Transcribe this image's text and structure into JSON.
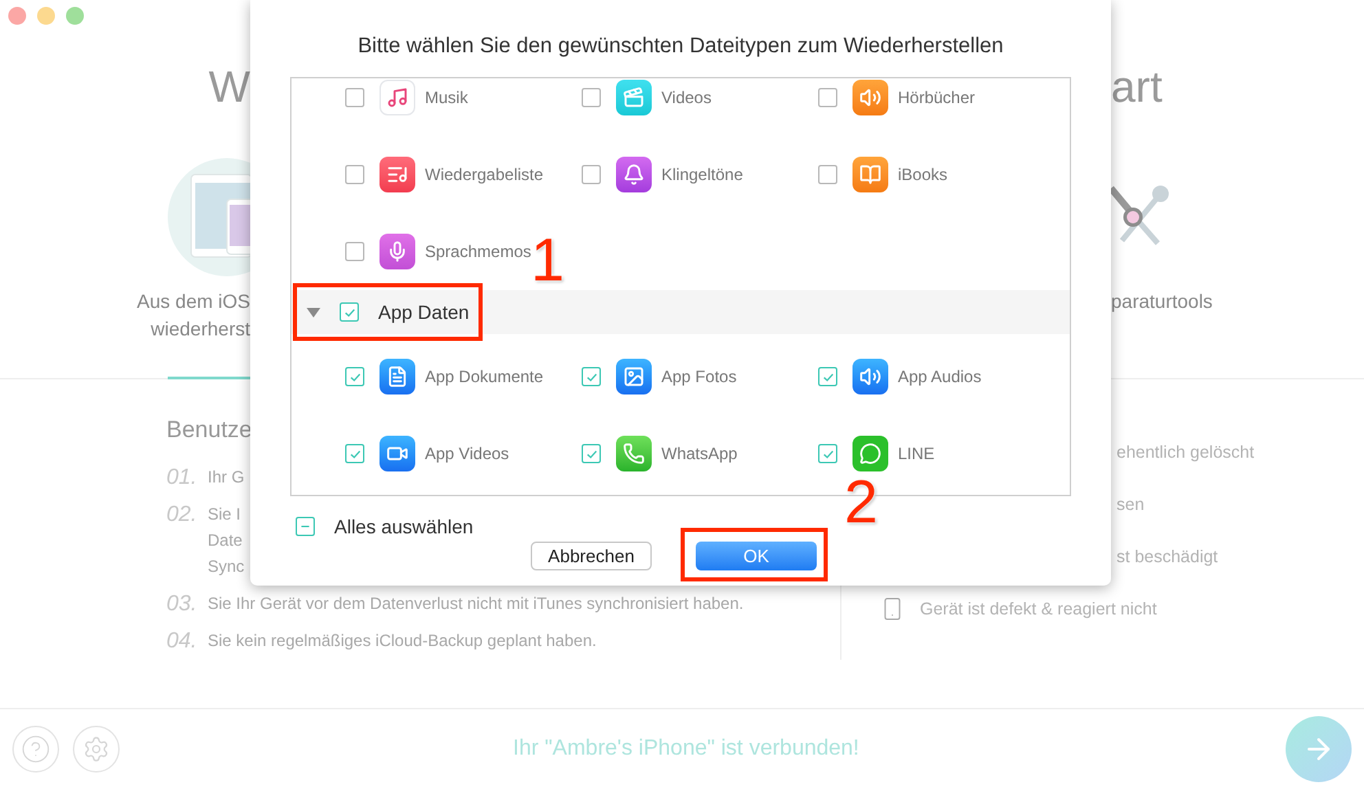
{
  "background": {
    "heading_left": "W",
    "heading_right": "art",
    "mode_left": [
      "Aus dem iOS",
      "wiederherst"
    ],
    "mode_right": "paraturtools",
    "guide": {
      "title": "Benutze",
      "items": [
        {
          "number": "01.",
          "lines": [
            "Ihr G"
          ]
        },
        {
          "number": "02.",
          "lines": [
            "Sie I",
            "Date",
            "Sync"
          ]
        },
        {
          "number": "03.",
          "lines": [
            "Sie Ihr Gerät vor dem Datenverlust nicht mit iTunes synchronisiert haben."
          ]
        },
        {
          "number": "04.",
          "lines": [
            "Sie kein regelmäßiges iCloud-Backup geplant haben."
          ]
        }
      ]
    },
    "causes": [
      {
        "text": "ehentlich gelöscht",
        "kind": "cut"
      },
      {
        "text": "sen",
        "kind": "cut"
      },
      {
        "text": "st beschädigt",
        "kind": "cut"
      },
      {
        "text": "Gerät ist defekt & reagiert nicht",
        "kind": "full"
      }
    ]
  },
  "footer": {
    "status": "Ihr \"Ambre's iPhone\" ist verbunden!"
  },
  "dialog": {
    "title": "Bitte wählen Sie den gewünschten Dateitypen zum Wiederherstellen",
    "groups": [
      {
        "items": [
          {
            "label": "Musik",
            "checked": false
          },
          {
            "label": "Videos",
            "checked": false
          },
          {
            "label": "Hörbücher",
            "checked": false
          },
          {
            "label": "Wiedergabeliste",
            "checked": false
          },
          {
            "label": "Klingeltöne",
            "checked": false
          },
          {
            "label": "iBooks",
            "checked": false
          },
          {
            "label": "Sprachmemos",
            "checked": false
          }
        ]
      },
      {
        "label": "App Daten",
        "checked": true,
        "expanded": true,
        "items": [
          {
            "label": "App Dokumente",
            "checked": true
          },
          {
            "label": "App Fotos",
            "checked": true
          },
          {
            "label": "App Audios",
            "checked": true
          },
          {
            "label": "App Videos",
            "checked": true
          },
          {
            "label": "WhatsApp",
            "checked": true
          },
          {
            "label": "LINE",
            "checked": true
          }
        ]
      }
    ],
    "select_all": {
      "label": "Alles auswählen",
      "indeterminate": true
    },
    "buttons": [
      {
        "label": "Abbrechen",
        "kind": "default"
      },
      {
        "label": "OK",
        "kind": "primary"
      }
    ]
  },
  "annotations": [
    {
      "label": "1"
    },
    {
      "label": "2"
    }
  ]
}
